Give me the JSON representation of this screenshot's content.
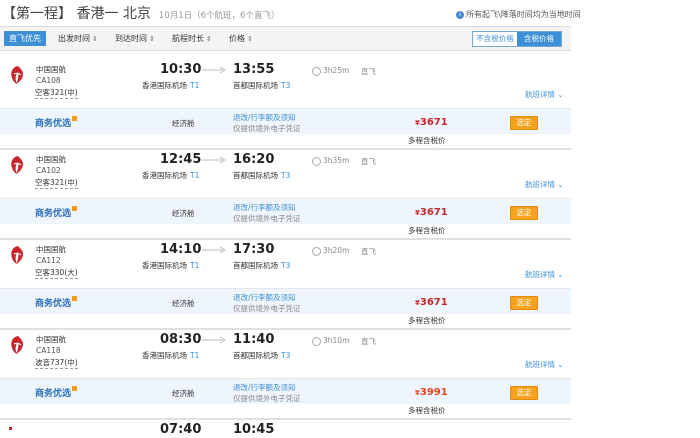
{
  "header": {
    "route": "【第一程】 香港一 北京",
    "date_info": "10月1日（6个航班，6个直飞）",
    "note": "所有起飞\\降落时间均为当地时间"
  },
  "sortbar": {
    "items": [
      "直飞优先",
      "出发时间",
      "到达时间",
      "航程时长",
      "价格"
    ],
    "tax_exclusive": "不含税价格",
    "tax_inclusive": "含税价格"
  },
  "common": {
    "airline": "中国国航",
    "direct": "直飞",
    "details": "航班详情",
    "promo": "商务优选",
    "cabin": "经济舱",
    "rule1": "退改/行李额及须知",
    "rule2": "仅提供境外电子凭证",
    "book": "选定",
    "multi_price": "多程含税价",
    "currency": "¥",
    "dep_terminal": "T1",
    "arr_terminal": "T3"
  },
  "flights": [
    {
      "flight_no": "CA108",
      "aircraft": "空客321(中)",
      "dep_time": "10:30",
      "arr_time": "13:55",
      "dep_airport": "香港国际机场",
      "arr_airport": "首都国际机场",
      "duration": "3h25m",
      "price": "3671"
    },
    {
      "flight_no": "CA102",
      "aircraft": "空客321(中)",
      "dep_time": "12:45",
      "arr_time": "16:20",
      "dep_airport": "香港国际机场",
      "arr_airport": "首都国际机场",
      "duration": "3h35m",
      "price": "3671"
    },
    {
      "flight_no": "CA112",
      "aircraft": "空客330(大)",
      "dep_time": "14:10",
      "arr_time": "17:30",
      "dep_airport": "香港国际机场",
      "arr_airport": "首都国际机场",
      "duration": "3h20m",
      "price": "3671"
    },
    {
      "flight_no": "CA118",
      "aircraft": "波音737(中)",
      "dep_time": "08:30",
      "arr_time": "11:40",
      "dep_airport": "香港国际机场",
      "arr_airport": "首都国际机场",
      "duration": "3h10m",
      "price": "3991"
    }
  ],
  "partial_next": {
    "dep_time": "07:40",
    "arr_time": "10:45"
  },
  "colors": {
    "accent": "#3d8fd6",
    "price": "#c8262d",
    "book_button": "#f5a31f",
    "airline_logo": "#c8262d"
  }
}
